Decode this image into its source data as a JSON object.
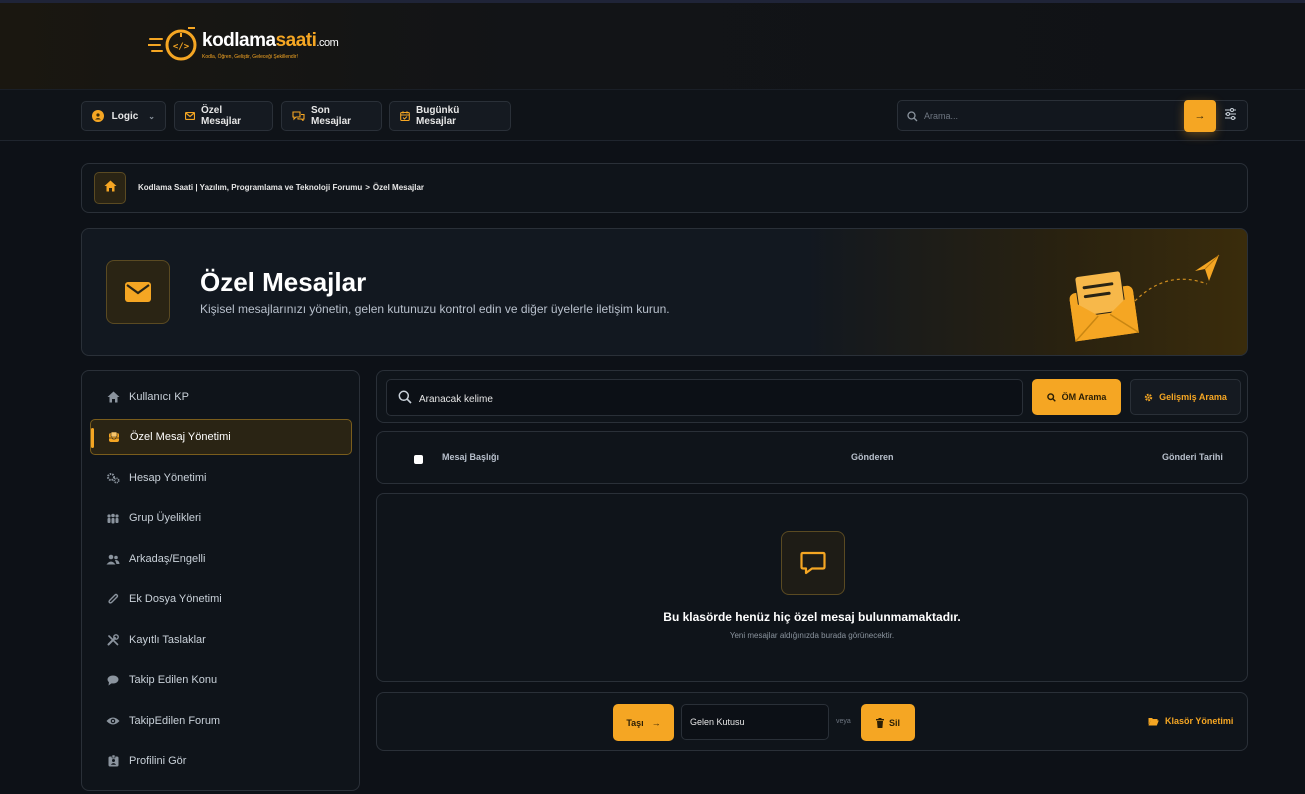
{
  "brand": {
    "name_part1": "kodlama",
    "name_part2": "saati",
    "tld": ".com",
    "tagline": "Kodla, Öğren, Geliştir, Geleceği Şekillendir!"
  },
  "nav": {
    "user_label": "Logic",
    "items": [
      {
        "label": "Özel Mesajlar",
        "icon": "envelope-icon"
      },
      {
        "label": "Son Mesajlar",
        "icon": "chat-bubbles-icon"
      },
      {
        "label": "Bugünkü Mesajlar",
        "icon": "calendar-icon"
      }
    ],
    "search_placeholder": "Arama..."
  },
  "breadcrumb": {
    "parent": "Kodlama Saati | Yazılım, Programlama ve Teknoloji Forumu",
    "separator": ">",
    "current": "Özel Mesajlar"
  },
  "hero": {
    "title": "Özel Mesajlar",
    "subtitle": "Kişisel mesajlarınızı yönetin, gelen kutunuzu kontrol edin ve diğer üyelerle iletişim kurun."
  },
  "sidebar": {
    "items": [
      {
        "label": "Kullanıcı KP",
        "icon": "home-icon",
        "active": false
      },
      {
        "label": "Özel Mesaj Yönetimi",
        "icon": "inbox-icon",
        "active": true
      },
      {
        "label": "Hesap Yönetimi",
        "icon": "gears-icon",
        "active": false
      },
      {
        "label": "Grup Üyelikleri",
        "icon": "group-icon",
        "active": false
      },
      {
        "label": "Arkadaş/Engelli",
        "icon": "users-icon",
        "active": false
      },
      {
        "label": "Ek Dosya Yönetimi",
        "icon": "paperclip-icon",
        "active": false
      },
      {
        "label": "Kayıtlı Taslaklar",
        "icon": "tools-icon",
        "active": false
      },
      {
        "label": "Takip Edilen Konu",
        "icon": "comment-icon",
        "active": false
      },
      {
        "label": "TakipEdilen Forum",
        "icon": "eye-icon",
        "active": false
      },
      {
        "label": "Profilini Gör",
        "icon": "id-badge-icon",
        "active": false
      }
    ]
  },
  "pm_search": {
    "input_value": "Aranacak kelime",
    "search_button": "ÖM Arama",
    "advanced_button": "Gelişmiş Arama"
  },
  "table": {
    "col_subject": "Mesaj Başlığı",
    "col_sender": "Gönderen",
    "col_date": "Gönderi Tarihi"
  },
  "empty_state": {
    "title": "Bu klasörde henüz hiç özel mesaj bulunmamaktadır.",
    "subtitle": "Yeni mesajlar aldığınızda burada görünecektir."
  },
  "actions": {
    "move_button": "Taşı",
    "folder_value": "Gelen Kutusu",
    "or_text": "veya",
    "delete_button": "Sil",
    "folder_management": "Klasör Yönetimi"
  },
  "colors": {
    "accent": "#f5a623",
    "background": "#0d1117",
    "panel": "#0f141a",
    "border": "#2a3038"
  }
}
